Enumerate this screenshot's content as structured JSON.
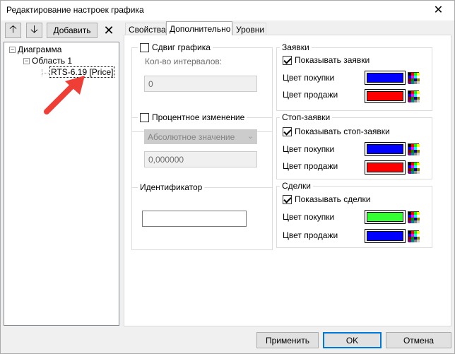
{
  "window": {
    "title": "Редактирование настроек графика",
    "close_glyph": "✕"
  },
  "toolbar": {
    "up_glyph": "🡡",
    "down_glyph": "🡣",
    "add_label": "Добавить",
    "delete_glyph": "✕"
  },
  "tree": {
    "root": {
      "label": "Диаграмма",
      "expander": "⊟"
    },
    "area": {
      "label": "Область 1",
      "expander": "⊟"
    },
    "instrument": {
      "label": "RTS-6.19 [Price]"
    }
  },
  "tabs": [
    {
      "label": "Свойства",
      "active": false
    },
    {
      "label": "Дополнительно",
      "active": true
    },
    {
      "label": "Уровни",
      "active": false
    }
  ],
  "shift": {
    "checkbox_label": "Сдвиг графика",
    "checked": false,
    "intervals_label": "Кол-во интервалов:",
    "intervals_value": "0"
  },
  "percent": {
    "checkbox_label": "Процентное изменение",
    "checked": false,
    "mode_value": "Абсолютное значение",
    "value": "0,000000"
  },
  "identifier": {
    "legend": "Идентификатор",
    "value": ""
  },
  "orders": {
    "legend": "Заявки",
    "checkbox_label": "Показывать заявки",
    "checked": true,
    "buy_label": "Цвет покупки",
    "buy_color": "#0000ff",
    "sell_label": "Цвет продажи",
    "sell_color": "#ff0000"
  },
  "stop_orders": {
    "legend": "Стоп-заявки",
    "checkbox_label": "Показывать стоп-заявки",
    "checked": true,
    "buy_label": "Цвет покупки",
    "buy_color": "#0000ff",
    "sell_label": "Цвет продажи",
    "sell_color": "#ff0000"
  },
  "trades": {
    "legend": "Сделки",
    "checkbox_label": "Показывать сделки",
    "checked": true,
    "buy_label": "Цвет покупки",
    "buy_color": "#33ff33",
    "sell_label": "Цвет продажи",
    "sell_color": "#0000ff"
  },
  "footer": {
    "apply_label": "Применить",
    "ok_label": "OK",
    "cancel_label": "Отмена"
  },
  "annotation_arrow_color": "#ef3e36"
}
